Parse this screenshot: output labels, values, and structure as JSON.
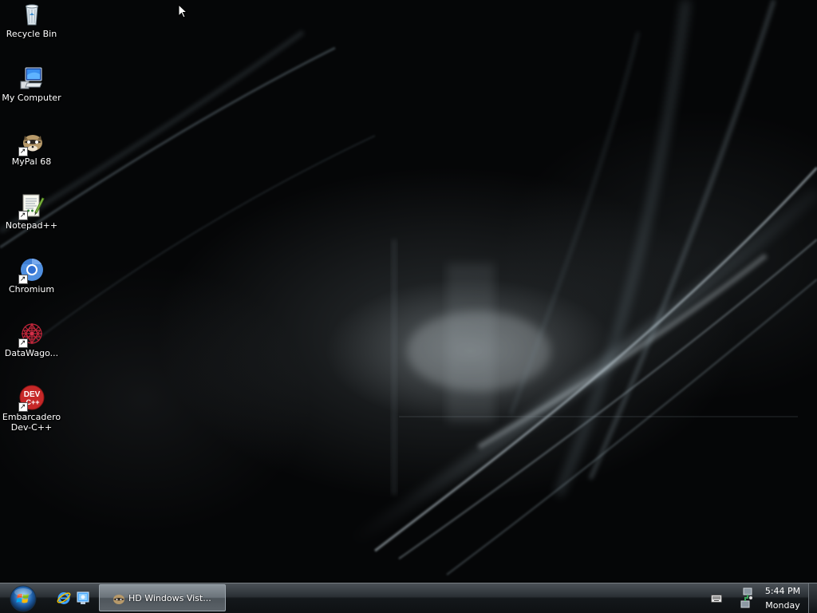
{
  "desktop": {
    "icons": [
      {
        "label": "Recycle Bin",
        "icon": "recycle-bin-icon",
        "shortcut": false
      },
      {
        "label": "My Computer",
        "icon": "computer-icon",
        "shortcut": false
      },
      {
        "label": "MyPal 68",
        "icon": "mypal-raccoon-icon",
        "shortcut": true
      },
      {
        "label": "Notepad++",
        "icon": "notepad-plus-plus-icon",
        "shortcut": true
      },
      {
        "label": "Chromium",
        "icon": "chromium-icon",
        "shortcut": true
      },
      {
        "label": "DataWago...",
        "icon": "datawagon-icon",
        "shortcut": true
      },
      {
        "label": "Embarcadero Dev-C++",
        "icon": "devcpp-icon",
        "shortcut": true,
        "badge_text": "DEV",
        "badge_sub": "C++"
      }
    ]
  },
  "taskbar": {
    "start_button": {
      "icon": "windows-orb-icon"
    },
    "quick_launch": [
      {
        "icon": "internet-explorer-icon"
      },
      {
        "icon": "show-desktop-quicklaunch-icon"
      }
    ],
    "tasks": [
      {
        "label": "HD Windows Vist...",
        "icon": "mypal-raccoon-icon"
      }
    ],
    "tray": {
      "icons": [
        "keyboard-icon",
        "network-icon"
      ],
      "time": "5:44 PM",
      "day": "Monday"
    }
  },
  "colors": {
    "wallpaper_base": "#050607",
    "taskbar_dark": "#0e1113",
    "taskbar_light": "#4b5157",
    "active_task": "#6b737a"
  }
}
